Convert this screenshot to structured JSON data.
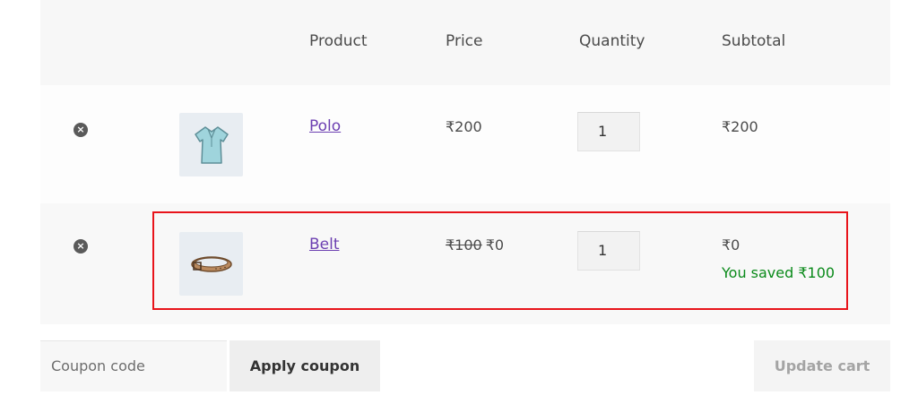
{
  "cart": {
    "columns": [
      "Product",
      "Price",
      "Quantity",
      "Subtotal"
    ],
    "items": [
      {
        "name": "Polo",
        "thumbnail_icon": "polo-shirt-icon",
        "price": "₹200",
        "quantity": "1",
        "subtotal": "₹200"
      },
      {
        "name": "Belt",
        "thumbnail_icon": "belt-icon",
        "price_original": "₹100",
        "price_current": "₹0",
        "quantity": "1",
        "subtotal": "₹0",
        "savings_note": "You saved ₹100"
      }
    ],
    "remove_symbol": "×"
  },
  "actions": {
    "coupon_placeholder": "Coupon code",
    "apply_label": "Apply coupon",
    "update_label": "Update cart"
  },
  "colors": {
    "link": "#6c3fb1",
    "savings": "#0a8a1a",
    "highlight": "#e8141b"
  }
}
